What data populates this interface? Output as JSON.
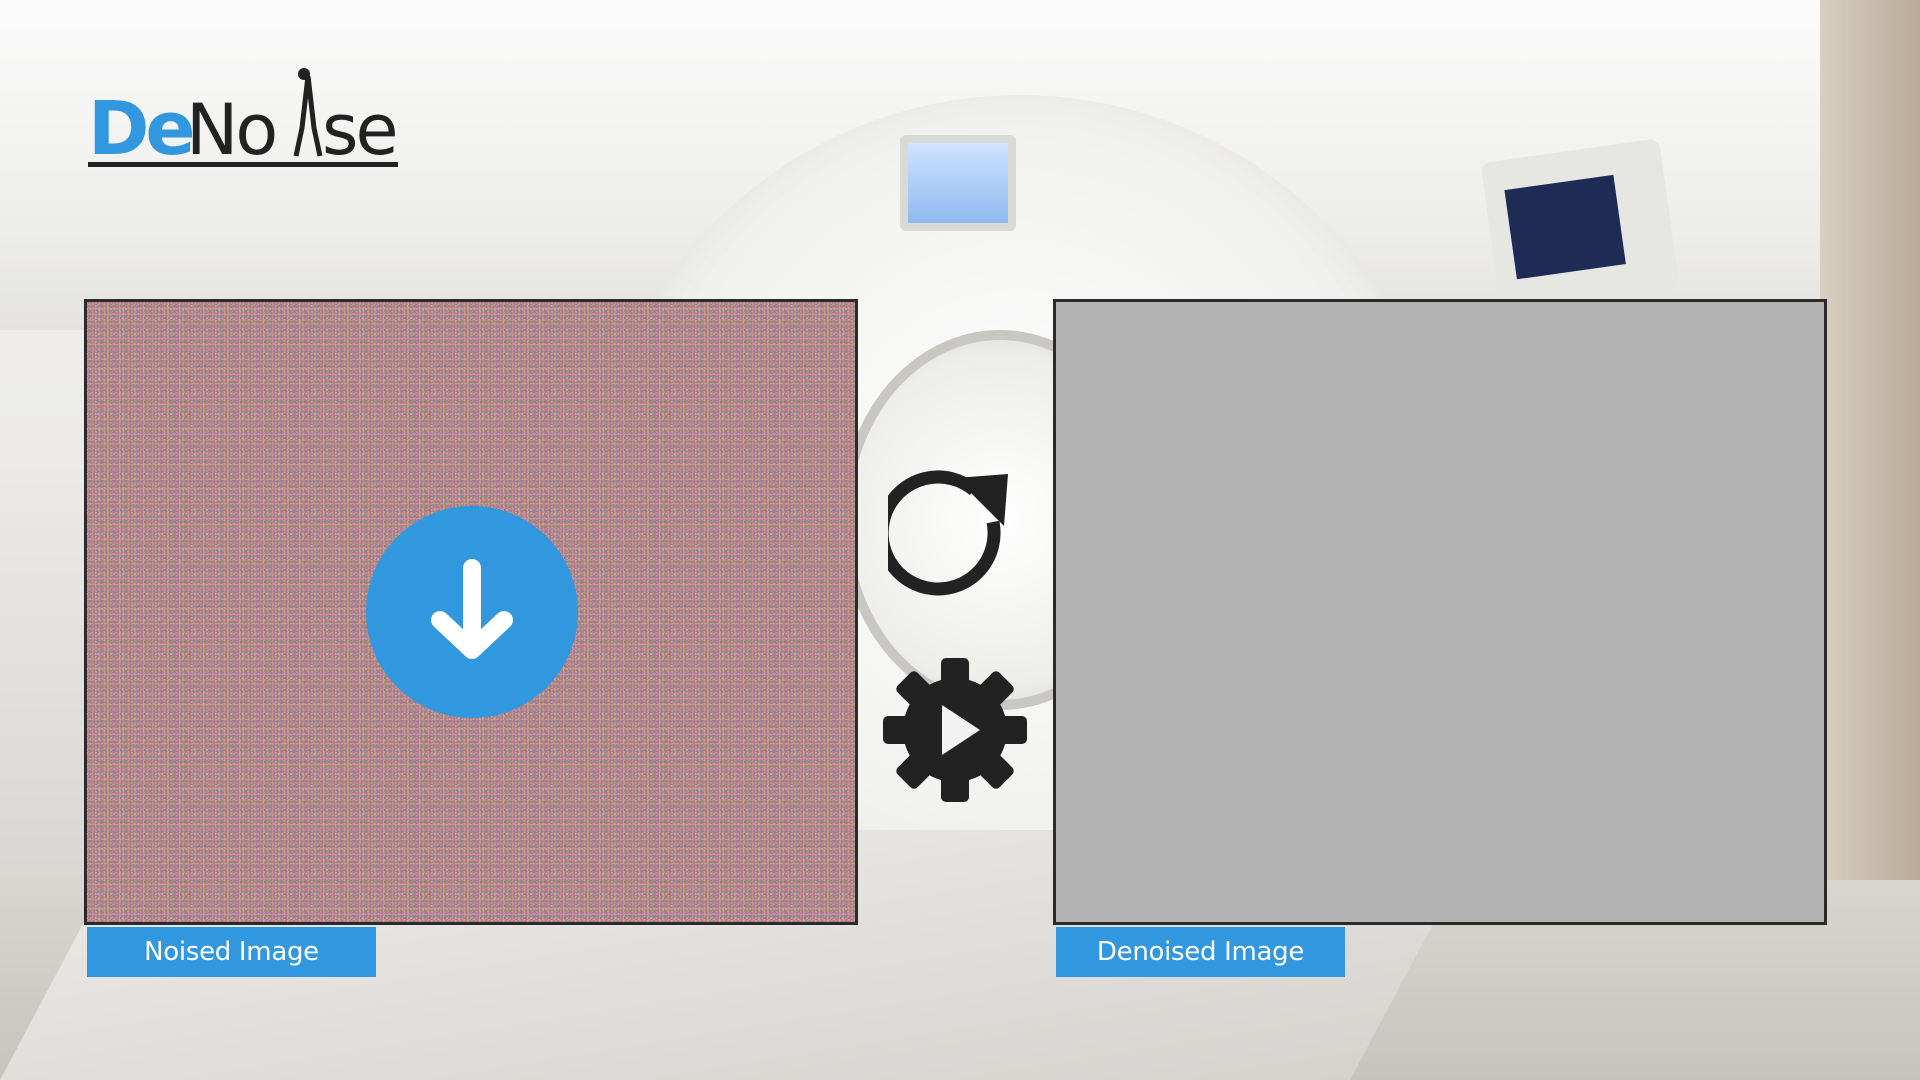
{
  "app": {
    "logo_text": "DeNoise",
    "brand_color": "#3198e0",
    "logo_dark_color": "#222222"
  },
  "panels": {
    "noised": {
      "label": "Noised Image",
      "icon": "download-arrow-icon"
    },
    "denoised": {
      "label": "Denoised Image"
    }
  },
  "controls": {
    "refresh_icon": "refresh-icon",
    "run_icon": "gear-play-icon"
  }
}
